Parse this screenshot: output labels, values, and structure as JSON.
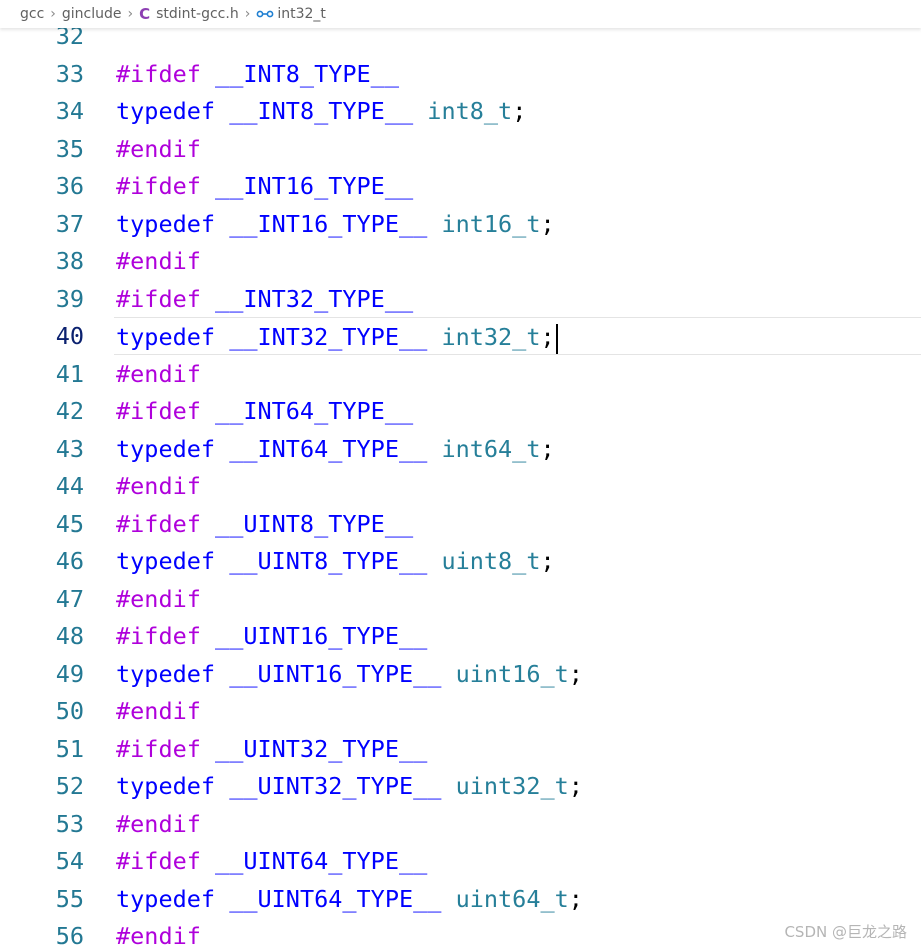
{
  "breadcrumb": {
    "items": [
      "gcc",
      "ginclude",
      "stdint-gcc.h",
      "int32_t"
    ],
    "separator": ">"
  },
  "icons": {
    "c_file": "C",
    "symbol": "symbol-variable-icon"
  },
  "colors": {
    "preprocessor": "#af00db",
    "keyword": "#0000ff",
    "type": "#267f99",
    "line_number": "#237893",
    "line_number_active": "#0b216f"
  },
  "editor": {
    "lines": [
      {
        "num": "32",
        "directive": "",
        "keyword": "",
        "macro": "",
        "type": "",
        "punct": ""
      },
      {
        "num": "33",
        "directive": "#ifdef",
        "keyword": "",
        "macro": "__INT8_TYPE__",
        "type": "",
        "punct": ""
      },
      {
        "num": "34",
        "directive": "",
        "keyword": "typedef",
        "macro": "__INT8_TYPE__",
        "type": "int8_t",
        "punct": ";"
      },
      {
        "num": "35",
        "directive": "#endif",
        "keyword": "",
        "macro": "",
        "type": "",
        "punct": ""
      },
      {
        "num": "36",
        "directive": "#ifdef",
        "keyword": "",
        "macro": "__INT16_TYPE__",
        "type": "",
        "punct": ""
      },
      {
        "num": "37",
        "directive": "",
        "keyword": "typedef",
        "macro": "__INT16_TYPE__",
        "type": "int16_t",
        "punct": ";"
      },
      {
        "num": "38",
        "directive": "#endif",
        "keyword": "",
        "macro": "",
        "type": "",
        "punct": ""
      },
      {
        "num": "39",
        "directive": "#ifdef",
        "keyword": "",
        "macro": "__INT32_TYPE__",
        "type": "",
        "punct": ""
      },
      {
        "num": "40",
        "directive": "",
        "keyword": "typedef",
        "macro": "__INT32_TYPE__",
        "type": "int32_t",
        "punct": ";"
      },
      {
        "num": "41",
        "directive": "#endif",
        "keyword": "",
        "macro": "",
        "type": "",
        "punct": ""
      },
      {
        "num": "42",
        "directive": "#ifdef",
        "keyword": "",
        "macro": "__INT64_TYPE__",
        "type": "",
        "punct": ""
      },
      {
        "num": "43",
        "directive": "",
        "keyword": "typedef",
        "macro": "__INT64_TYPE__",
        "type": "int64_t",
        "punct": ";"
      },
      {
        "num": "44",
        "directive": "#endif",
        "keyword": "",
        "macro": "",
        "type": "",
        "punct": ""
      },
      {
        "num": "45",
        "directive": "#ifdef",
        "keyword": "",
        "macro": "__UINT8_TYPE__",
        "type": "",
        "punct": ""
      },
      {
        "num": "46",
        "directive": "",
        "keyword": "typedef",
        "macro": "__UINT8_TYPE__",
        "type": "uint8_t",
        "punct": ";"
      },
      {
        "num": "47",
        "directive": "#endif",
        "keyword": "",
        "macro": "",
        "type": "",
        "punct": ""
      },
      {
        "num": "48",
        "directive": "#ifdef",
        "keyword": "",
        "macro": "__UINT16_TYPE__",
        "type": "",
        "punct": ""
      },
      {
        "num": "49",
        "directive": "",
        "keyword": "typedef",
        "macro": "__UINT16_TYPE__",
        "type": "uint16_t",
        "punct": ";"
      },
      {
        "num": "50",
        "directive": "#endif",
        "keyword": "",
        "macro": "",
        "type": "",
        "punct": ""
      },
      {
        "num": "51",
        "directive": "#ifdef",
        "keyword": "",
        "macro": "__UINT32_TYPE__",
        "type": "",
        "punct": ""
      },
      {
        "num": "52",
        "directive": "",
        "keyword": "typedef",
        "macro": "__UINT32_TYPE__",
        "type": "uint32_t",
        "punct": ";"
      },
      {
        "num": "53",
        "directive": "#endif",
        "keyword": "",
        "macro": "",
        "type": "",
        "punct": ""
      },
      {
        "num": "54",
        "directive": "#ifdef",
        "keyword": "",
        "macro": "__UINT64_TYPE__",
        "type": "",
        "punct": ""
      },
      {
        "num": "55",
        "directive": "",
        "keyword": "typedef",
        "macro": "__UINT64_TYPE__",
        "type": "uint64_t",
        "punct": ";"
      },
      {
        "num": "56",
        "directive": "#endif",
        "keyword": "",
        "macro": "",
        "type": "",
        "punct": ""
      }
    ],
    "active_line": "40"
  },
  "watermark": "CSDN @巨龙之路"
}
